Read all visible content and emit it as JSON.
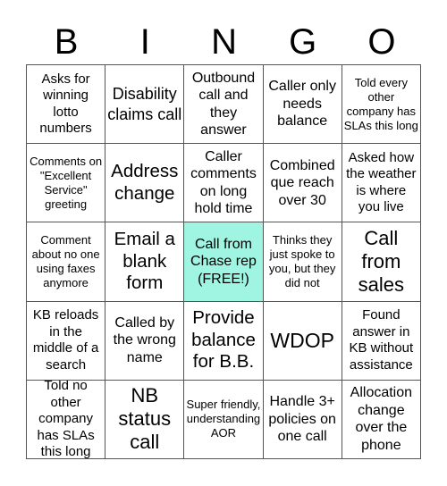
{
  "header": {
    "letters": [
      "B",
      "I",
      "N",
      "G",
      "O"
    ]
  },
  "free_color": "#9ff5e2",
  "cells": [
    [
      "Asks for winning lotto numbers",
      "Disability claims call",
      "Outbound call and they answer",
      "Caller only needs balance",
      "Told every other company has SLAs this long"
    ],
    [
      "Comments on \"Excellent Service\" greeting",
      "Address change",
      "Caller comments on long hold time",
      "Combined que reach over 30",
      "Asked how the weather is where you live"
    ],
    [
      "Comment about no one using faxes anymore",
      "Email a blank form",
      "Call from Chase rep (FREE!)",
      "Thinks they just spoke to you, but they did not",
      "Call from sales"
    ],
    [
      "KB reloads in the middle of a search",
      "Called by the wrong name",
      "Provide balance for B.B.",
      "WDOP",
      "Found answer in KB without assistance"
    ],
    [
      "Told no other company has SLAs this long",
      "NB status call",
      "Super friendly, understanding AOR",
      "Handle 3+ policies on one call",
      "Allocation change over the phone"
    ]
  ]
}
